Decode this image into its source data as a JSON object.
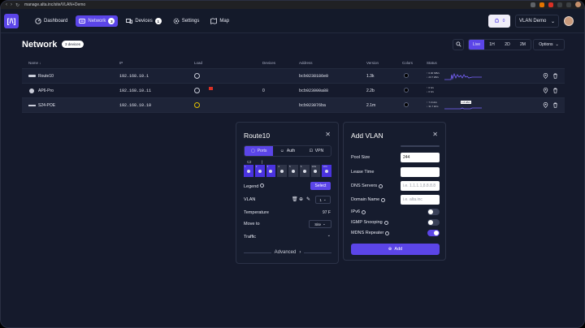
{
  "browser": {
    "url": "manage.alta.inc/site/VLAN+Demo"
  },
  "header": {
    "logo": "[/\\]",
    "nav": [
      {
        "label": "Dashboard",
        "icon": "dashboard-icon"
      },
      {
        "label": "Network",
        "icon": "network-icon",
        "badge": "3",
        "active": true
      },
      {
        "label": "Devices",
        "icon": "devices-icon",
        "badge": "1"
      },
      {
        "label": "Settings",
        "icon": "gear-icon"
      },
      {
        "label": "Map",
        "icon": "map-icon"
      }
    ],
    "notif_count": "0",
    "org_name": "VLAN Demo"
  },
  "page": {
    "title": "Network",
    "device_count": "3 devices",
    "ranges": [
      "Live",
      "1H",
      "2D",
      "2M"
    ],
    "active_range": "Live",
    "options_label": "Options"
  },
  "table": {
    "columns": [
      "Name",
      "IP",
      "Load",
      "Devices",
      "Address",
      "Version",
      "Colors",
      "Status"
    ],
    "rows": [
      {
        "name": "Route10",
        "ip": "192.168.10.1",
        "devices": "",
        "address": "bcb9238186e0",
        "version": "1.3k",
        "status_up": "↑ 0.00 MB/s",
        "status_down": "↓ 23.7 kB/s"
      },
      {
        "name": "AP6-Pro",
        "ip": "192.168.10.11",
        "devices": "0",
        "address": "bcb923000a88",
        "version": "2.2b",
        "status_up": "↑ 0 b/s",
        "status_down": "↓ 0 b/s"
      },
      {
        "name": "S24-POE",
        "ip": "192.168.10.10",
        "devices": "",
        "address": "bcb923076ba",
        "version": "2.1m",
        "status_up": "↑ 7.0 kb/s",
        "status_down": "↓ 31.7 kb/s",
        "badge": "1.8 kB/s"
      }
    ]
  },
  "route_panel": {
    "title": "Route10",
    "tabs": [
      "Ports",
      "Auth",
      "VPN"
    ],
    "active_tab": "Ports",
    "ports": [
      {
        "num": "1",
        "on": true
      },
      {
        "num": "2",
        "on": true
      },
      {
        "num": "3",
        "on": true
      },
      {
        "num": "4",
        "on": false
      },
      {
        "num": "5",
        "on": false
      },
      {
        "num": "6",
        "on": false
      },
      {
        "num": "10G",
        "on": false
      },
      {
        "num": "10G",
        "on": true
      }
    ],
    "legend_label": "Legend",
    "select_label": "Select",
    "vlan_label": "VLAN",
    "vlan_value": "1",
    "temperature_label": "Temperature",
    "temperature_value": "97 F",
    "move_to_label": "Move to",
    "move_to_value": "Site",
    "traffic_label": "Traffic",
    "advanced_label": "Advanced"
  },
  "vlan_panel": {
    "title": "Add VLAN",
    "pool_size_label": "Pool Size",
    "pool_size_value": "244",
    "lease_time_label": "Lease Time",
    "lease_time_value": "",
    "dns_label": "DNS Servers",
    "dns_placeholder": "i.e. 1.1.1.1,8.8.8.8",
    "domain_label": "Domain Name",
    "domain_placeholder": "i.e. alta.inc",
    "ipv6_label": "IPv6",
    "igmp_label": "IGMP Snooping",
    "mdns_label": "MDNS Repeater",
    "add_label": "Add"
  }
}
